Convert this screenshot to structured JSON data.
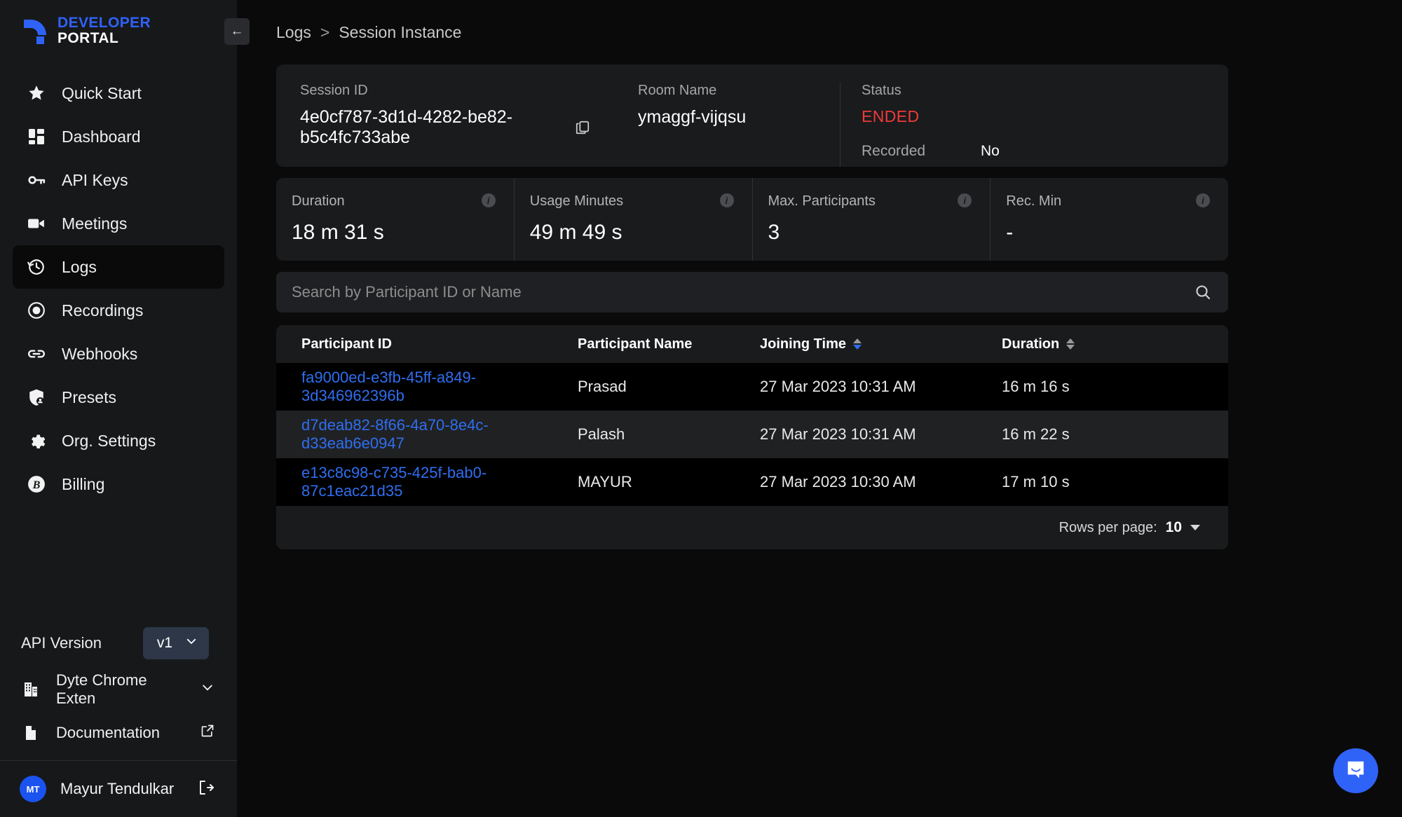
{
  "brand": {
    "line1": "DEVELOPER",
    "line2": "PORTAL",
    "logo_color": "#2f62f7"
  },
  "sidebar": {
    "collapse_label": "←",
    "items": [
      {
        "label": "Quick Start",
        "icon": "star-icon"
      },
      {
        "label": "Dashboard",
        "icon": "grid-icon"
      },
      {
        "label": "API Keys",
        "icon": "key-icon"
      },
      {
        "label": "Meetings",
        "icon": "video-camera-icon"
      },
      {
        "label": "Logs",
        "icon": "history-clock-icon"
      },
      {
        "label": "Recordings",
        "icon": "record-circle-icon"
      },
      {
        "label": "Webhooks",
        "icon": "link-icon"
      },
      {
        "label": "Presets",
        "icon": "shield-user-icon"
      },
      {
        "label": "Org. Settings",
        "icon": "gear-icon"
      },
      {
        "label": "Billing",
        "icon": "bitcoin-icon"
      }
    ],
    "active_item": "Logs",
    "api_version": {
      "label": "API Version",
      "value": "v1"
    },
    "chrome_extension": {
      "label": "Dyte Chrome Exten",
      "icon": "building-icon"
    },
    "documentation": {
      "label": "Documentation",
      "icon": "document-icon"
    },
    "user": {
      "initials": "MT",
      "name": "Mayur Tendulkar"
    }
  },
  "breadcrumb": {
    "parent": "Logs",
    "separator": ">",
    "current": "Session Instance"
  },
  "session": {
    "session_id_label": "Session ID",
    "session_id": "4e0cf787-3d1d-4282-be82-b5c4fc733abe",
    "room_name_label": "Room Name",
    "room_name": "ymaggf-vijqsu",
    "status_label": "Status",
    "status": "ENDED",
    "status_color": "#f03a3a",
    "recorded_label": "Recorded",
    "recorded": "No"
  },
  "stats": [
    {
      "label": "Duration",
      "value": "18 m 31 s"
    },
    {
      "label": "Usage Minutes",
      "value": "49 m 49 s"
    },
    {
      "label": "Max. Participants",
      "value": "3"
    },
    {
      "label": "Rec. Min",
      "value": "-"
    }
  ],
  "search": {
    "placeholder": "Search by Participant ID or Name",
    "value": ""
  },
  "table": {
    "columns": [
      {
        "label": "Participant ID",
        "sortable": false
      },
      {
        "label": "Participant Name",
        "sortable": false
      },
      {
        "label": "Joining Time",
        "sortable": true,
        "sort": "desc"
      },
      {
        "label": "Duration",
        "sortable": true,
        "sort": "none"
      }
    ],
    "rows": [
      {
        "participant_id": "fa9000ed-e3fb-45ff-a849-3d346962396b",
        "name": "Prasad",
        "joining_time": "27 Mar 2023 10:31 AM",
        "duration": "16 m 16 s"
      },
      {
        "participant_id": "d7deab82-8f66-4a70-8e4c-d33eab6e0947",
        "name": "Palash",
        "joining_time": "27 Mar 2023 10:31 AM",
        "duration": "16 m 22 s"
      },
      {
        "participant_id": "e13c8c98-c735-425f-bab0-87c1eac21d35",
        "name": "MAYUR",
        "joining_time": "27 Mar 2023 10:30 AM",
        "duration": "17 m 10 s"
      }
    ],
    "footer": {
      "rows_per_page_label": "Rows per page:",
      "rows_per_page": "10"
    }
  },
  "chat": {
    "icon": "chat-bubble-icon",
    "color": "#2f62f7"
  }
}
